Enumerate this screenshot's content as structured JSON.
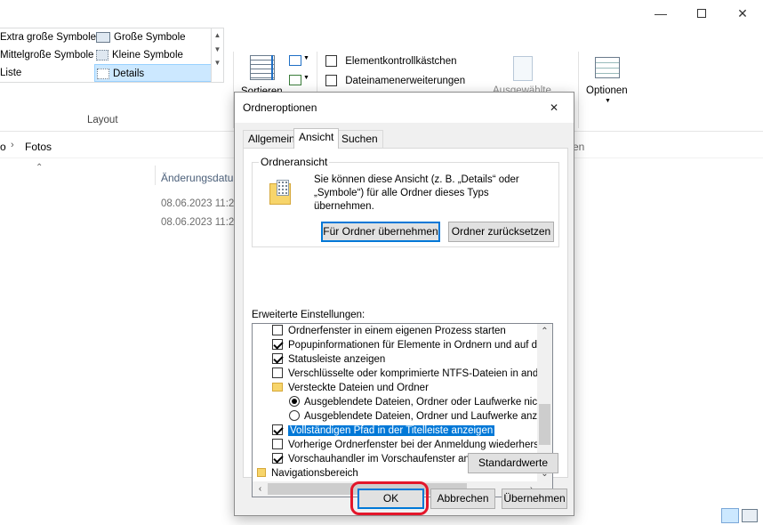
{
  "window": {
    "minimize_icon": "minimize-icon",
    "maximize_icon": "maximize-icon",
    "close_icon": "close-icon"
  },
  "ribbon": {
    "views": {
      "extra_large": "Extra große Symbole",
      "large": "Große Symbole",
      "medium": "Mittelgroße Symbole",
      "small": "Kleine Symbole",
      "list": "Liste",
      "details": "Details"
    },
    "layout_label": "Layout",
    "sort_label": "Sortieren",
    "checkboxes": {
      "item_checkboxes": "Elementkontrollkästchen",
      "file_extensions": "Dateinamenerweiterungen"
    },
    "selected_label": "Ausgewählte",
    "options_label": "Optionen"
  },
  "address": {
    "prev": "o",
    "folder": "Fotos",
    "search_partial": "en"
  },
  "list": {
    "column_header": "Änderungsdatu",
    "rows": [
      "08.06.2023 11:25",
      "08.06.2023 11:25"
    ]
  },
  "dialog": {
    "title": "Ordneroptionen",
    "tabs": [
      "Allgemein",
      "Ansicht",
      "Suchen"
    ],
    "folder_view": {
      "label": "Ordneransicht",
      "description": "Sie können diese Ansicht (z. B. „Details“ oder „Symbole“) für alle Ordner dieses Typs übernehmen.",
      "apply_button": "Für Ordner übernehmen",
      "reset_button": "Ordner zurücksetzen"
    },
    "advanced_label": "Erweiterte Einstellungen:",
    "settings": [
      {
        "type": "checkbox",
        "checked": false,
        "label": "Ordnerfenster in einem eigenen Prozess starten"
      },
      {
        "type": "checkbox",
        "checked": true,
        "label": "Popupinformationen für Elemente in Ordnern und auf dem D"
      },
      {
        "type": "checkbox",
        "checked": true,
        "label": "Statusleiste anzeigen"
      },
      {
        "type": "checkbox",
        "checked": false,
        "label": "Verschlüsselte oder komprimierte NTFS-Dateien in anderer"
      },
      {
        "type": "folder",
        "label": "Versteckte Dateien und Ordner"
      },
      {
        "type": "radio",
        "checked": true,
        "label": "Ausgeblendete Dateien, Ordner oder Laufwerke nicht a"
      },
      {
        "type": "radio",
        "checked": false,
        "label": "Ausgeblendete Dateien, Ordner und Laufwerke anzeig"
      },
      {
        "type": "checkbox",
        "checked": true,
        "label": "Vollständigen Pfad in der Titelleiste anzeigen",
        "highlighted": true
      },
      {
        "type": "checkbox",
        "checked": false,
        "label": "Vorherige Ordnerfenster bei der Anmeldung wiederherstellen"
      },
      {
        "type": "checkbox",
        "checked": true,
        "label": "Vorschauhandler im Vorschaufenster anzeigen"
      },
      {
        "type": "nav",
        "label": "Navigationsbereich"
      }
    ],
    "defaults_button": "Standardwerte",
    "ok_button": "OK",
    "cancel_button": "Abbrechen",
    "apply_button": "Übernehmen"
  },
  "colors": {
    "accent": "#0078d7",
    "highlight_ring": "#e3162a"
  }
}
